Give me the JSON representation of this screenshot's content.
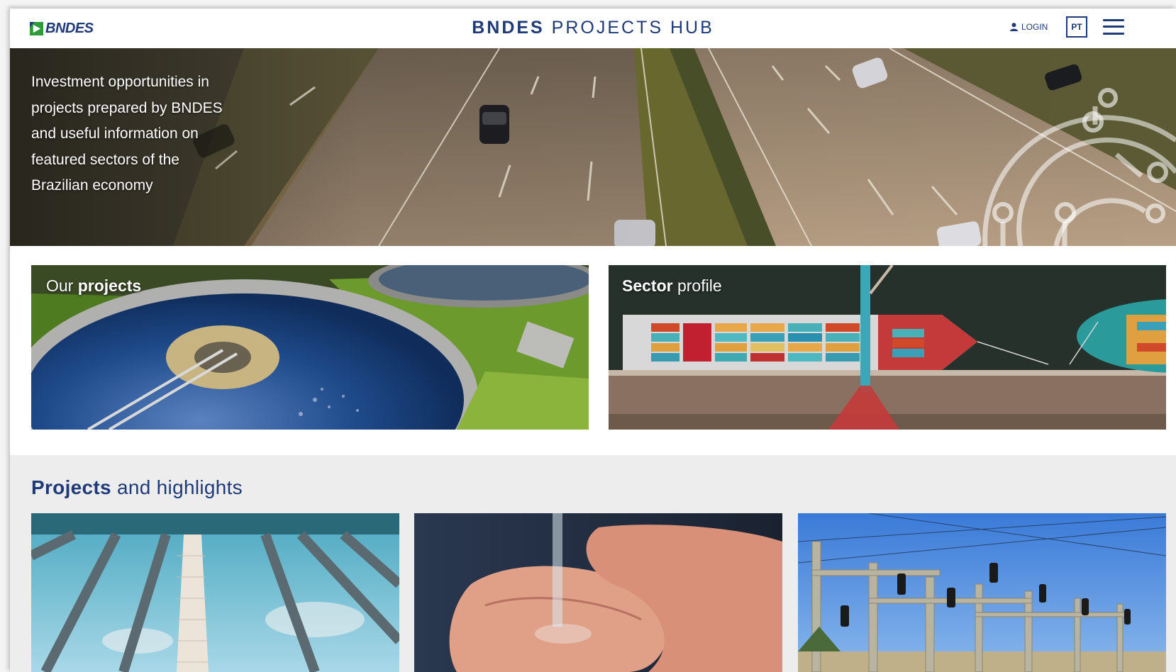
{
  "header": {
    "logo_text": "BNDES",
    "title_strong": "BNDES",
    "title_rest": " PROJECTS HUB",
    "login_label": "LOGIN",
    "lang_label": "PT"
  },
  "hero": {
    "text": "Investment opportunities in projects prepared by BNDES and useful information on featured sectors of the Brazilian economy"
  },
  "features": [
    {
      "title_plain": "Our ",
      "title_bold": "projects"
    },
    {
      "title_bold": "Sector",
      "title_plain": " profile"
    }
  ],
  "highlights": {
    "title_bold": "Projects",
    "title_plain": " and highlights"
  },
  "colors": {
    "brand_blue": "#1e3a78",
    "logo_green": "#2e9a3a"
  }
}
